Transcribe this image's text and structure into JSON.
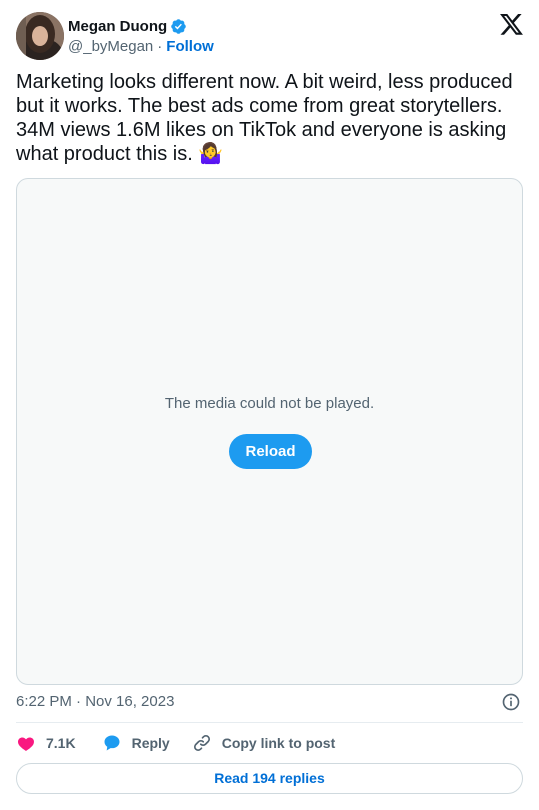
{
  "author": {
    "display_name": "Megan Duong",
    "handle": "@_byMegan",
    "separator": "·",
    "follow_label": "Follow"
  },
  "tweet": {
    "text": "Marketing looks different now. A bit weird, less produced but it works. The best ads come from great storytellers. 34M views 1.6M likes on TikTok and everyone is asking what product this is. 🤷‍♀️"
  },
  "media": {
    "error_message": "The media could not be played.",
    "reload_label": "Reload"
  },
  "meta": {
    "timestamp": "6:22 PM · Nov 16, 2023"
  },
  "actions": {
    "likes": "7.1K",
    "reply_label": "Reply",
    "copy_link_label": "Copy link to post"
  },
  "footer": {
    "read_replies_label": "Read 194 replies"
  },
  "colors": {
    "accent": "#1d9bf0",
    "link": "#006fd6",
    "like": "#f91880",
    "secondary_text": "#536471"
  }
}
